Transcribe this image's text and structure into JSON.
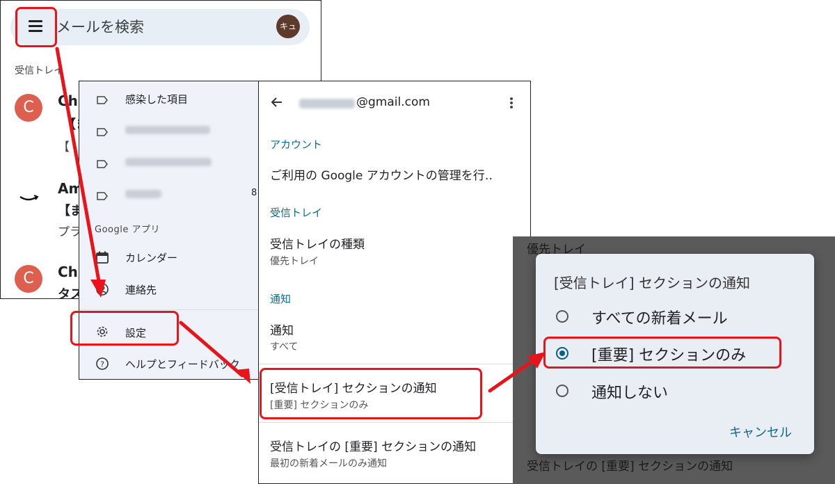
{
  "inbox": {
    "search_placeholder": "メールを検索",
    "avatar_text": "キュ",
    "section_label": "受信トレイ",
    "items": [
      {
        "avatar": "C",
        "sender": "Ch",
        "subject": "【ま",
        "snippet": "【"
      },
      {
        "sender": "Am",
        "subject": "【ま",
        "snippet": "プラ"
      },
      {
        "avatar": "C",
        "sender": "Ch",
        "subject": "タス"
      }
    ]
  },
  "drawer": {
    "items": [
      {
        "label": "感染した項目"
      },
      {
        "label": ""
      },
      {
        "label": ""
      },
      {
        "label": "",
        "count": "8"
      }
    ],
    "apps_header": "Google アプリ",
    "calendar": "カレンダー",
    "contacts": "連絡先",
    "settings": "設定",
    "help": "ヘルプとフィードバック"
  },
  "settings": {
    "account_email": "@gmail.com",
    "account_header": "アカウント",
    "manage_account": "ご利用の Google アカウントの管理を行‥",
    "inbox_header": "受信トレイ",
    "inbox_type_title": "受信トレイの種類",
    "inbox_type_value": "優先トレイ",
    "notify_header": "通知",
    "notify_title": "通知",
    "notify_value": "すべて",
    "section_notify_title": "[受信トレイ] セクションの通知",
    "section_notify_value": "[重要] セクションのみ",
    "important_notify_title": "受信トレイの [重要] セクションの通知",
    "important_notify_value": "最初の新着メールのみ通知"
  },
  "bg_panel": {
    "top_text": "優先トレイ",
    "bottom_text": "受信トレイの [重要] セクションの通知"
  },
  "dialog": {
    "title": "[受信トレイ] セクションの通知",
    "options": [
      "すべての新着メール",
      "[重要] セクションのみ",
      "通知しない"
    ],
    "selected_index": 1,
    "cancel": "キャンセル"
  },
  "colors": {
    "highlight": "#e8141b",
    "accent": "#0b6b8a",
    "avatar_red": "#dc5f4f"
  }
}
